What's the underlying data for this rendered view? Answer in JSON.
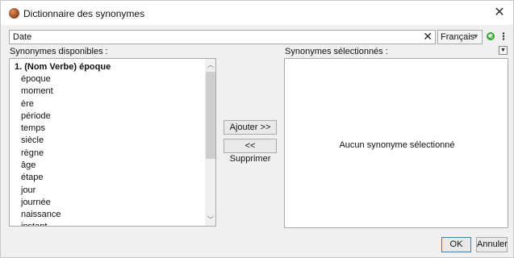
{
  "window": {
    "title": "Dictionnaire des synonymes"
  },
  "search": {
    "value": "Date"
  },
  "language": {
    "selected": "Français"
  },
  "labels": {
    "available": "Synonymes disponibles :",
    "selected": "Synonymes sélectionnés :"
  },
  "list": {
    "heading": "1. (Nom Verbe) époque",
    "items": [
      "époque",
      "moment",
      "ère",
      "période",
      "temps",
      "siècle",
      "règne",
      "âge",
      "étape",
      "jour",
      "journée",
      "naissance",
      "instant"
    ]
  },
  "buttons": {
    "add": "Ajouter >>",
    "remove": "<< Supprimer",
    "ok": "OK",
    "cancel": "Annuler"
  },
  "selected_box": {
    "empty_message": "Aucun synonyme sélectionné"
  },
  "colors": {
    "status_ok": "#33a533",
    "accent_border": "#3c7fb1"
  }
}
